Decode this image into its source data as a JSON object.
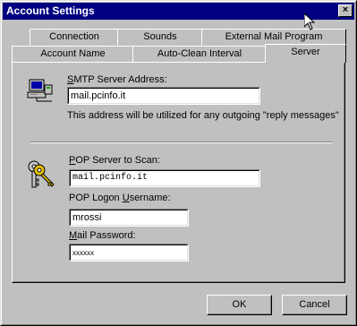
{
  "window": {
    "title": "Account Settings",
    "close_glyph": "×"
  },
  "tabs": {
    "row1": [
      {
        "label": "Connection"
      },
      {
        "label": "Sounds"
      },
      {
        "label": "External Mail Program"
      }
    ],
    "row2": [
      {
        "label": "Account Name"
      },
      {
        "label": "Auto-Clean Interval"
      },
      {
        "label": "Server",
        "active": true
      }
    ]
  },
  "smtp": {
    "label_prefix": "",
    "label_underlined": "S",
    "label_rest": "MTP Server Address:",
    "value": "mail.pcinfo.it",
    "note": "This address will be utilized for any outgoing \"reply messages\""
  },
  "pop": {
    "server_label_underlined": "P",
    "server_label_rest": "OP Server to Scan:",
    "server_value": "mail.pcinfo.it",
    "username_label_prefix": "POP Logon ",
    "username_label_underlined": "U",
    "username_label_rest": "sername:",
    "username_value": "mrossi",
    "password_label_underlined": "M",
    "password_label_rest": "ail Password:",
    "password_value": "xxxxxx"
  },
  "buttons": {
    "ok": "OK",
    "cancel": "Cancel"
  },
  "icons": {
    "smtp": "computer-network-icon",
    "pop": "keys-icon",
    "close": "close-icon",
    "cursor": "mouse-cursor-icon"
  }
}
